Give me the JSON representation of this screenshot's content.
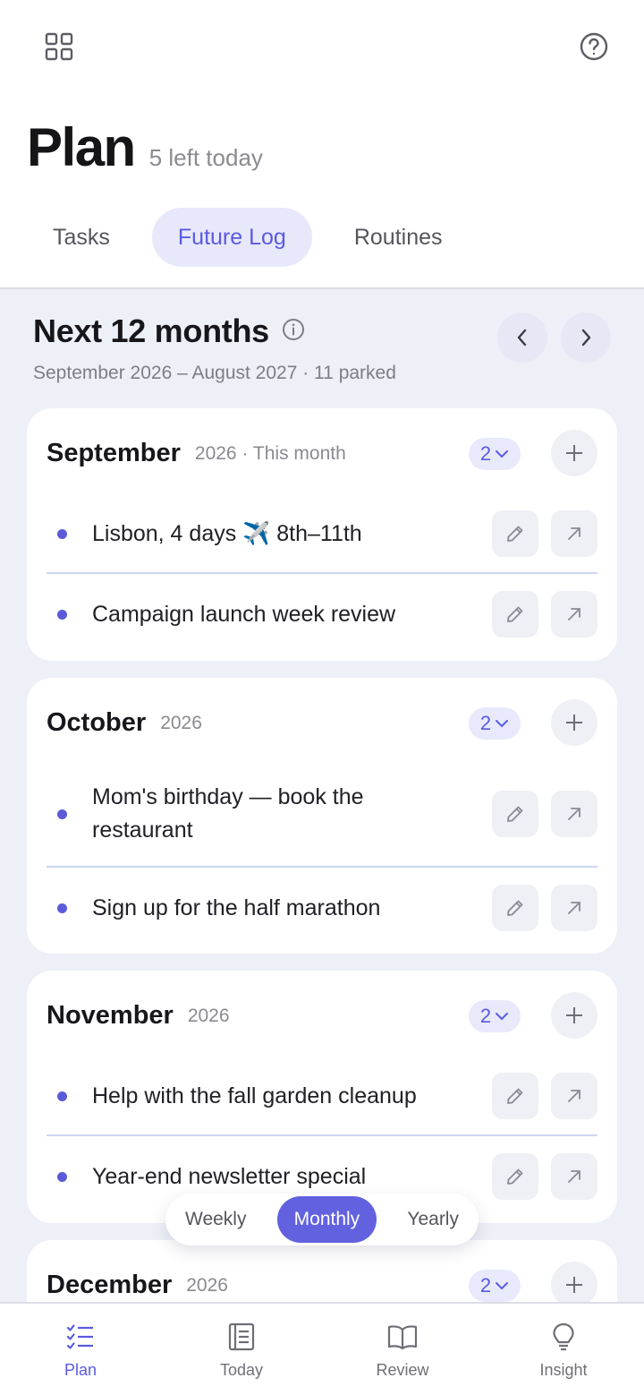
{
  "header": {
    "grid_icon": "grid-icon",
    "help_icon": "help-circle-icon",
    "title": "Plan",
    "subtitle": "5 left today"
  },
  "tabs": [
    {
      "label": "Tasks",
      "active": false
    },
    {
      "label": "Future Log",
      "active": true
    },
    {
      "label": "Routines",
      "active": false
    }
  ],
  "section": {
    "title": "Next 12 months",
    "info_icon": "info-icon",
    "subtitle": "September 2026 – August 2027 · 11 parked"
  },
  "months": [
    {
      "name": "September",
      "meta": "2026 · This month",
      "count": "2",
      "items": [
        {
          "text": "Lisbon, 4 days ✈️ 8th–11th"
        },
        {
          "text": "Campaign launch week review"
        }
      ]
    },
    {
      "name": "October",
      "meta": "2026",
      "count": "2",
      "items": [
        {
          "text": "Mom's birthday — book the restaurant"
        },
        {
          "text": "Sign up for the half marathon"
        }
      ]
    },
    {
      "name": "November",
      "meta": "2026",
      "count": "2",
      "items": [
        {
          "text": "Help with the fall garden cleanup"
        },
        {
          "text": "Year-end newsletter special"
        }
      ]
    },
    {
      "name": "December",
      "meta": "2026",
      "count": "2",
      "items": []
    }
  ],
  "view_toggle": [
    {
      "label": "Weekly",
      "active": false
    },
    {
      "label": "Monthly",
      "active": true
    },
    {
      "label": "Yearly",
      "active": false
    }
  ],
  "bottom_nav": [
    {
      "label": "Plan",
      "icon": "checklist-icon",
      "active": true
    },
    {
      "label": "Today",
      "icon": "journal-icon",
      "active": false
    },
    {
      "label": "Review",
      "icon": "book-icon",
      "active": false
    },
    {
      "label": "Insight",
      "icon": "lightbulb-icon",
      "active": false
    }
  ],
  "colors": {
    "accent": "#5a5ae0",
    "accent_soft": "#e8e8fb",
    "background": "#eef0f8",
    "card": "#ffffff"
  }
}
